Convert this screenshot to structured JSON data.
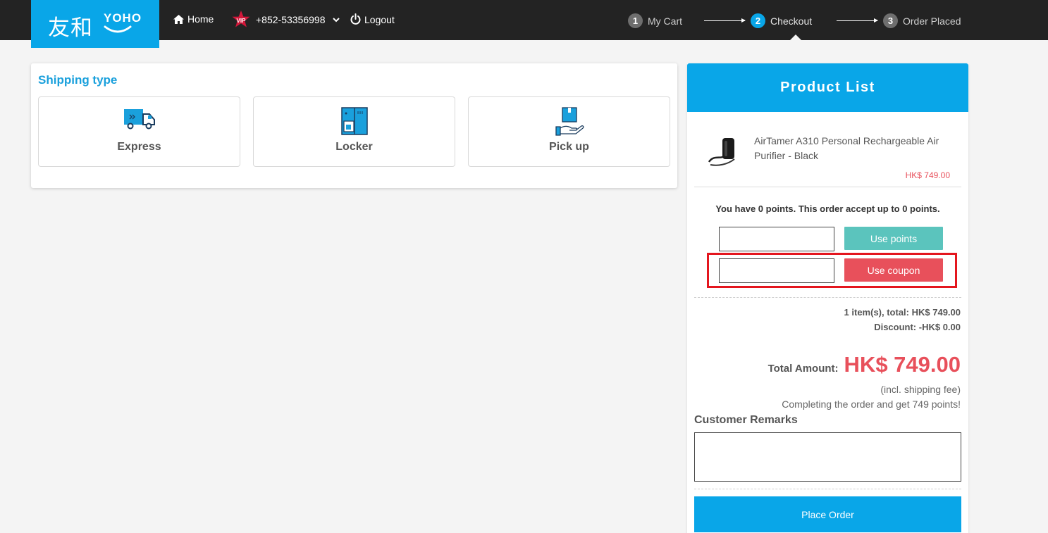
{
  "header": {
    "logo_cn": "友和",
    "logo_en": "YOHO",
    "home_label": "Home",
    "vip_badge": "VIP",
    "phone": "+852-53356998",
    "logout_label": "Logout",
    "icons": {
      "home": "home-icon",
      "vip": "vip-star-icon",
      "dropdown": "chevron-down-icon",
      "logout": "power-icon"
    }
  },
  "steps": [
    {
      "num": "1",
      "label": "My Cart"
    },
    {
      "num": "2",
      "label": "Checkout"
    },
    {
      "num": "3",
      "label": "Order Placed"
    }
  ],
  "shipping": {
    "title": "Shipping type",
    "options": [
      {
        "label": "Express",
        "icon": "delivery-truck-icon"
      },
      {
        "label": "Locker",
        "icon": "locker-icon"
      },
      {
        "label": "Pick up",
        "icon": "hand-package-icon"
      }
    ]
  },
  "product_list": {
    "title": "Product List",
    "items": [
      {
        "name": "AirTamer A310 Personal Rechargeable Air Purifier - Black",
        "price": "HK$ 749.00"
      }
    ],
    "points_message": "You have 0 points. This order accept up to 0 points.",
    "points_input_value": "",
    "use_points_label": "Use points",
    "coupon_input_value": "",
    "use_coupon_label": "Use coupon",
    "items_total": "1 item(s), total: HK$ 749.00",
    "discount": "Discount: -HK$ 0.00",
    "total_label": "Total Amount:",
    "total_amount": "HK$ 749.00",
    "shipping_note": "(incl. shipping fee)",
    "points_note": "Completing the order and get 749 points!",
    "remarks_title": "Customer Remarks",
    "remarks_value": "",
    "place_order_label": "Place Order"
  },
  "colors": {
    "brand_blue": "#09a6e8",
    "topbar": "#232323",
    "teal_button": "#5bc4bd",
    "coupon_red": "#e8505b",
    "highlight_red": "#e4161e"
  }
}
